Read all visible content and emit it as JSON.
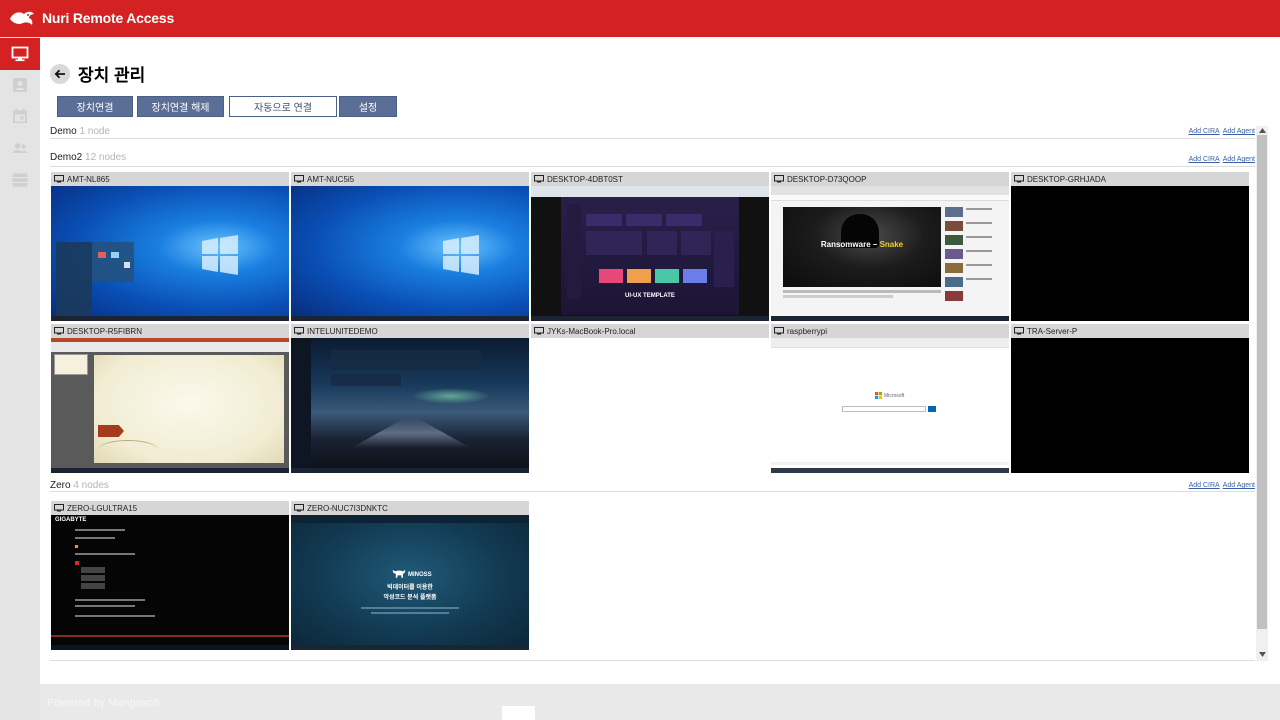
{
  "app": {
    "brand": "Nuri Remote Access"
  },
  "sidebar": {
    "items": [
      {
        "name": "devices",
        "icon": "monitor-icon",
        "active": true
      },
      {
        "name": "account",
        "icon": "user-card-icon",
        "active": false
      },
      {
        "name": "events",
        "icon": "calendar-icon",
        "active": false
      },
      {
        "name": "users",
        "icon": "users-icon",
        "active": false
      },
      {
        "name": "servers",
        "icon": "server-icon",
        "active": false
      }
    ]
  },
  "page": {
    "title": "장치 관리"
  },
  "toolbar": {
    "connect_label": "장치연결",
    "disconnect_label": "장치연결 해제",
    "auto_connect_label": "자동으로 연결",
    "settings_label": "설정"
  },
  "groups": [
    {
      "name": "Demo",
      "count": " 1 node",
      "links": [
        "Add CIRA",
        "Add Agent"
      ]
    },
    {
      "name": "Demo2",
      "count": " 12 nodes",
      "links": [
        "Add CIRA",
        "Add Agent"
      ]
    },
    {
      "name": "Zero",
      "count": " 4 nodes",
      "links": [
        "Add CIRA",
        "Add Agent"
      ]
    }
  ],
  "devices": [
    {
      "name": "AMT-NL865",
      "screen": "win10-start"
    },
    {
      "name": "AMT-NUC5i5",
      "screen": "win10"
    },
    {
      "name": "DESKTOP-4DBT0ST",
      "screen": "dashboard",
      "caption": "UI-UX TEMPLATE"
    },
    {
      "name": "DESKTOP-D73QOOP",
      "screen": "youtube",
      "caption_a": "Ransomware – ",
      "caption_b": "Snake"
    },
    {
      "name": "DESKTOP-GRHJADA",
      "screen": "black"
    },
    {
      "name": "DESKTOP-R5FIBRN",
      "screen": "powerpoint"
    },
    {
      "name": "INTELUNITEDEMO",
      "screen": "aurora"
    },
    {
      "name": "JYKs-MacBook-Pro.local",
      "screen": "white"
    },
    {
      "name": "raspberrypi",
      "screen": "browser",
      "caption": "Microsoft"
    },
    {
      "name": "TRA-Server-P",
      "screen": "black"
    },
    {
      "name": "ZERO-LGULTRA15",
      "screen": "bios",
      "caption": "GIGABYTE"
    },
    {
      "name": "ZERO-NUC7I3DNKTC",
      "screen": "minoss",
      "caption_a": "MINOSS",
      "caption_b": "빅데이터를 이용한",
      "caption_c": "악성코드 분석 플랫폼"
    }
  ],
  "footer": {
    "text": "Powered by Mangosoft"
  },
  "colors": {
    "brand_red": "#d42121",
    "button_blue": "#5b6e96",
    "link_blue": "#3b5ea5"
  }
}
